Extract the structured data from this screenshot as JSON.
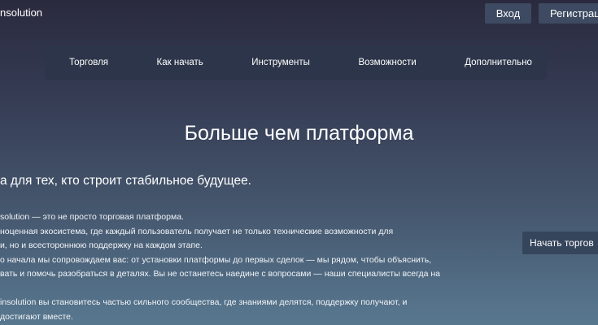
{
  "header": {
    "logo_text": "nsolution",
    "login_label": "Вход",
    "register_label": "Регистрац"
  },
  "nav": {
    "items": [
      {
        "label": "Торговля"
      },
      {
        "label": "Как начать"
      },
      {
        "label": "Инструменты"
      },
      {
        "label": "Возможности"
      },
      {
        "label": "Дополнительно"
      }
    ]
  },
  "hero": {
    "title": "Больше чем платформа",
    "subtitle": "а для тех, кто строит стабильное будущее."
  },
  "content": {
    "lines": [
      "solution — это не просто торговая платформа.",
      "ноценная экосистема, где каждый пользователь получает не только технические возможности для",
      "и, но и всестороннюю поддержку на каждом этапе.",
      "о начала мы сопровождаем вас: от установки платформы до первых сделок — мы рядом, чтобы объяснить,",
      "вать и помочь разобраться в деталях. Вы не останетесь наедине с вопросами — наши специалисты всегда на",
      "insolution вы становитесь частью сильного сообщества, где знаниями делятся, поддержку получают, и",
      "достигают вместе."
    ]
  },
  "cta": {
    "start_label": "Начать торгов"
  }
}
